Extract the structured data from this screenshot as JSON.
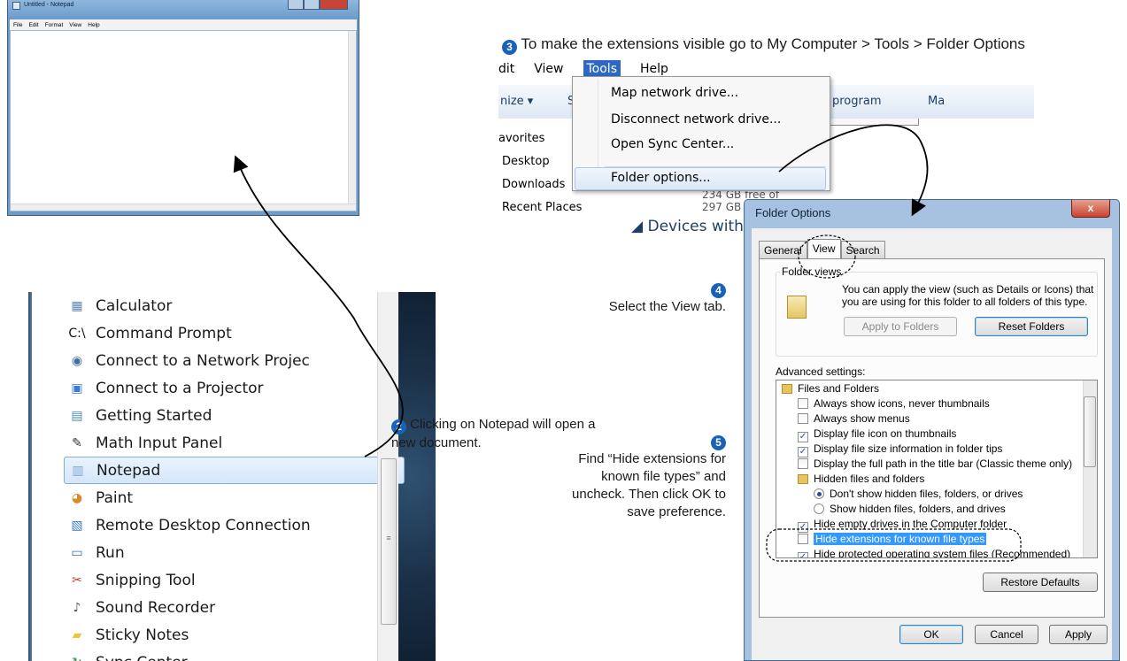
{
  "notepad": {
    "title": "Untitled - Notepad",
    "menu": [
      "File",
      "Edit",
      "Format",
      "View",
      "Help"
    ]
  },
  "start_menu": {
    "items": [
      {
        "label": "Calculator",
        "icon": "calculator-icon",
        "glyph": "▦",
        "color": "#5f86b5"
      },
      {
        "label": "Command Prompt",
        "icon": "command-prompt-icon",
        "glyph": "C:\\",
        "color": "#111111"
      },
      {
        "label": "Connect to a Network Projec",
        "icon": "network-projector-icon",
        "glyph": "◉",
        "color": "#3e6ea5"
      },
      {
        "label": "Connect to a Projector",
        "icon": "projector-icon",
        "glyph": "▣",
        "color": "#3a7bd5"
      },
      {
        "label": "Getting Started",
        "icon": "getting-started-icon",
        "glyph": "▤",
        "color": "#4a8bd0"
      },
      {
        "label": "Math Input Panel",
        "icon": "math-input-icon",
        "glyph": "✎",
        "color": "#333333"
      },
      {
        "label": "Notepad",
        "icon": "notepad-icon",
        "glyph": "▥",
        "color": "#7aa7d6"
      },
      {
        "label": "Paint",
        "icon": "paint-icon",
        "glyph": "◕",
        "color": "#d98a2b"
      },
      {
        "label": "Remote Desktop Connection",
        "icon": "remote-desktop-icon",
        "glyph": "▧",
        "color": "#3a7bd5"
      },
      {
        "label": "Run",
        "icon": "run-icon",
        "glyph": "▭",
        "color": "#2d6fc0"
      },
      {
        "label": "Snipping Tool",
        "icon": "scissors-icon",
        "glyph": "✂",
        "color": "#c0392b"
      },
      {
        "label": "Sound Recorder",
        "icon": "microphone-icon",
        "glyph": "♪",
        "color": "#555555"
      },
      {
        "label": "Sticky Notes",
        "icon": "sticky-notes-icon",
        "glyph": "▰",
        "color": "#e8c63c"
      },
      {
        "label": "Sync Center",
        "icon": "sync-icon",
        "glyph": "↻",
        "color": "#2e9b3f"
      }
    ],
    "selected_item": "Notepad"
  },
  "steps": {
    "step2_number": "2",
    "step2_text": "Clicking on Notepad will open a new document.",
    "step3_number": "3",
    "step3_text": "To make the extensions visible go to My Computer > Tools > Folder Options",
    "step4_number": "4",
    "step4_text": "Select the View tab.",
    "step5_number": "5",
    "step5_text": "Find “Hide extensions for known file types” and uncheck. Then click OK to save preference.",
    "badge_color": "#1863b7"
  },
  "explorer": {
    "menu": [
      "dit",
      "View",
      "Tools",
      "Help"
    ],
    "toolbar": [
      "nize ▾",
      "S",
      "program",
      "Ma"
    ],
    "nav": [
      "avorites",
      "Desktop",
      "Downloads",
      "Recent Places"
    ],
    "free_space": "234 GB free of 297 GB",
    "devices": "Devices with",
    "tools_menu": [
      "Map network drive...",
      "Disconnect network drive...",
      "Open Sync Center...",
      "Folder options..."
    ]
  },
  "folder_options": {
    "title": "Folder Options",
    "close_label": "x",
    "tabs": [
      "General",
      "View",
      "Search"
    ],
    "active_tab": "View",
    "group_label": "Folder views",
    "group_text": "You can apply the view (such as Details or Icons) that you are using for this folder to all folders of this type.",
    "apply_button": "Apply to Folders",
    "reset_button": "Reset Folders",
    "advanced_label": "Advanced settings:",
    "tree": [
      {
        "kind": "folder",
        "indent": 0,
        "label": "Files and Folders"
      },
      {
        "kind": "checkbox",
        "indent": 1,
        "checked": false,
        "label": "Always show icons, never thumbnails"
      },
      {
        "kind": "checkbox",
        "indent": 1,
        "checked": false,
        "label": "Always show menus"
      },
      {
        "kind": "checkbox",
        "indent": 1,
        "checked": true,
        "label": "Display file icon on thumbnails"
      },
      {
        "kind": "checkbox",
        "indent": 1,
        "checked": true,
        "label": "Display file size information in folder tips"
      },
      {
        "kind": "checkbox",
        "indent": 1,
        "checked": false,
        "label": "Display the full path in the title bar (Classic theme only)"
      },
      {
        "kind": "folder",
        "indent": 1,
        "label": "Hidden files and folders"
      },
      {
        "kind": "radio",
        "indent": 2,
        "checked": true,
        "label": "Don't show hidden files, folders, or drives"
      },
      {
        "kind": "radio",
        "indent": 2,
        "checked": false,
        "label": "Show hidden files, folders, and drives"
      },
      {
        "kind": "checkbox",
        "indent": 1,
        "checked": true,
        "label": "Hide empty drives in the Computer folder"
      },
      {
        "kind": "checkbox",
        "indent": 1,
        "checked": false,
        "label": "Hide extensions for known file types",
        "highlight": true
      },
      {
        "kind": "checkbox",
        "indent": 1,
        "checked": true,
        "label": "Hide protected operating system files (Recommended)"
      }
    ],
    "restore_button": "Restore Defaults",
    "ok_button": "OK",
    "cancel_button": "Cancel",
    "apply_footer_button": "Apply"
  }
}
